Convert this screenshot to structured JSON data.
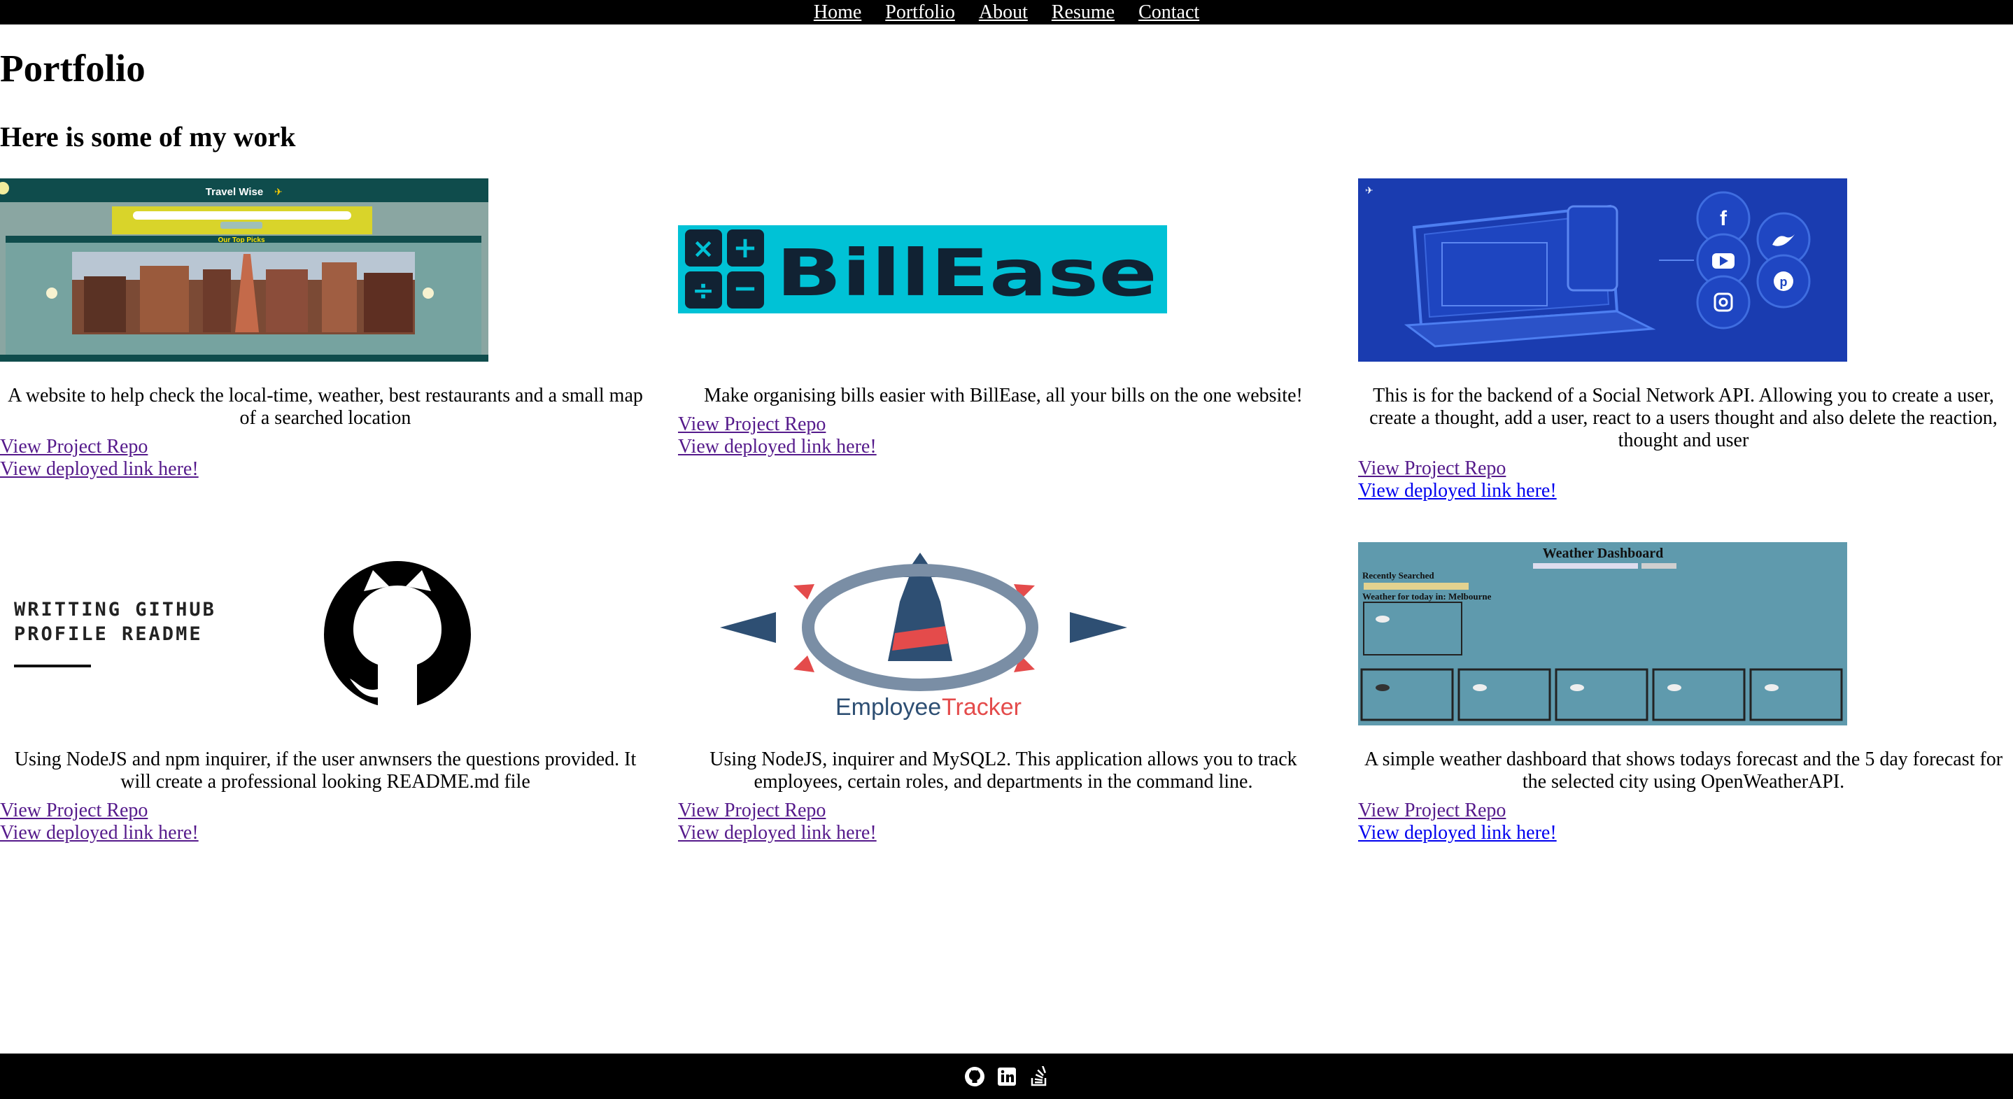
{
  "nav": {
    "items": [
      "Home",
      "Portfolio",
      "About",
      "Resume",
      "Contact"
    ]
  },
  "page": {
    "title": "Portfolio",
    "subtitle": "Here is some of my work"
  },
  "projects": [
    {
      "thumb": "travel-wise-screenshot",
      "thumb_title": "Travel Wise",
      "thumb_section": "Our Top Picks",
      "description": "A website to help check the local-time, weather, best restaurants and a small map of a searched location",
      "repo_label": "View Project Repo",
      "deploy_label": "View deployed link here!"
    },
    {
      "thumb": "billease-logo",
      "thumb_title": "BillEase",
      "description": "Make organising bills easier with BillEase, all your bills on the one website!",
      "repo_label": "View Project Repo",
      "deploy_label": "View deployed link here!"
    },
    {
      "thumb": "social-network-illustration",
      "description": "This is for the backend of a Social Network API. Allowing you to create a user, create a thought, add a user, react to a users thought and also delete the reaction, thought and user",
      "repo_label": "View Project Repo",
      "deploy_label": "View deployed link here!"
    },
    {
      "thumb": "github-readme-graphic",
      "thumb_title_line1": "WRITTING GITHUB",
      "thumb_title_line2": "PROFILE README",
      "description": "Using NodeJS and npm inquirer, if the user anwnsers the questions provided. It will create a professional looking README.md file",
      "repo_label": "View Project Repo",
      "deploy_label": "View deployed link here!"
    },
    {
      "thumb": "employee-tracker-logo",
      "thumb_title_a": "Employee",
      "thumb_title_b": "Tracker",
      "description": "Using NodeJS, inquirer and MySQL2. This application allows you to track employees, certain roles, and departments in the command line.",
      "repo_label": "View Project Repo",
      "deploy_label": "View deployed link here!"
    },
    {
      "thumb": "weather-dashboard-screenshot",
      "thumb_title": "Weather Dashboard",
      "thumb_recent": "Recently Searched",
      "thumb_today": "Weather for today in: Melbourne",
      "description": "A simple weather dashboard that shows todays forecast and the 5 day forecast for the selected city using OpenWeatherAPI.",
      "repo_label": "View Project Repo",
      "deploy_label": "View deployed link here!"
    }
  ],
  "footer": {
    "icons": [
      "github-icon",
      "linkedin-icon",
      "stackoverflow-icon"
    ]
  },
  "colors": {
    "nav_bg": "#000000",
    "link_visited": "#551a8b",
    "link_unvisited": "#0000ee",
    "billease_bg": "#00c2d6",
    "social_bg": "#1a3cb0",
    "weather_bg": "#5f9aad"
  }
}
